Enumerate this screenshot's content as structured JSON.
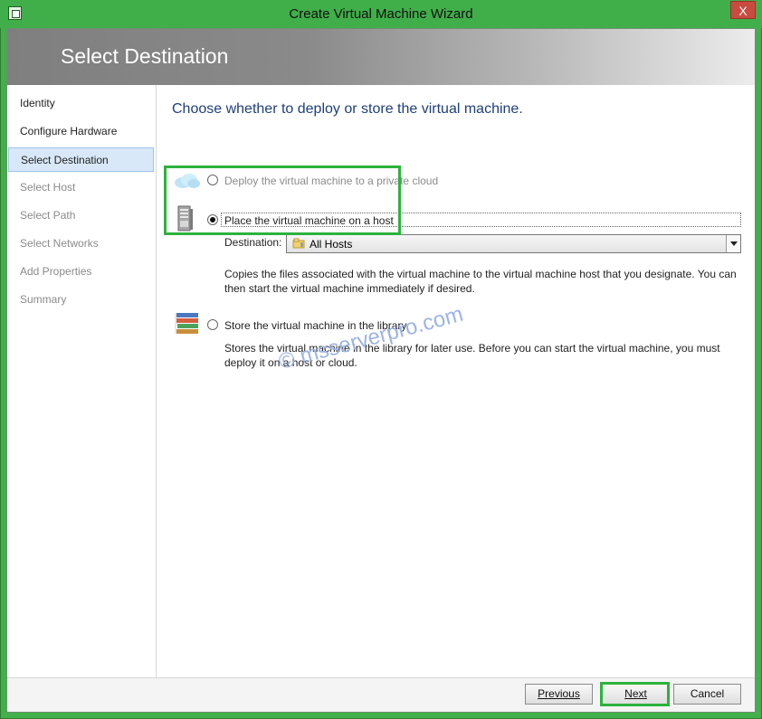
{
  "window": {
    "title": "Create Virtual Machine Wizard",
    "close_label": "X"
  },
  "header": {
    "title": "Select Destination"
  },
  "sidebar": {
    "items": [
      {
        "label": "Identity",
        "state": "enabled"
      },
      {
        "label": "Configure Hardware",
        "state": "enabled"
      },
      {
        "label": "Select Destination",
        "state": "active"
      },
      {
        "label": "Select Host",
        "state": "disabled"
      },
      {
        "label": "Select Path",
        "state": "disabled"
      },
      {
        "label": "Select Networks",
        "state": "disabled"
      },
      {
        "label": "Add Properties",
        "state": "disabled"
      },
      {
        "label": "Summary",
        "state": "disabled"
      }
    ]
  },
  "main": {
    "heading": "Choose whether to deploy or store the virtual machine.",
    "options": {
      "cloud": {
        "label": "Deploy the virtual machine to a private cloud",
        "selected": false,
        "enabled": false,
        "icon": "cloud-icon"
      },
      "host": {
        "label": "Place the virtual machine on a host",
        "selected": true,
        "enabled": true,
        "icon": "server-icon",
        "destination_label": "Destination:",
        "destination_value": "All Hosts",
        "description": "Copies the files associated with the virtual machine to the virtual machine host that you designate. You can then start the virtual machine immediately if desired."
      },
      "library": {
        "label": "Store the virtual machine in the library",
        "selected": false,
        "enabled": true,
        "icon": "library-icon",
        "description": "Stores the virtual machine in the library for later use. Before you can start the virtual machine, you must deploy it on a host or cloud."
      }
    }
  },
  "buttons": {
    "previous": "Previous",
    "next": "Next",
    "cancel": "Cancel"
  },
  "watermark": "© msserverpro.com",
  "colors": {
    "window_frame": "#41b04a",
    "header_dark": "#7f7f7f",
    "heading_text": "#1f3f7a",
    "active_nav": "#d8e8f8",
    "highlight": "#2db23d"
  }
}
